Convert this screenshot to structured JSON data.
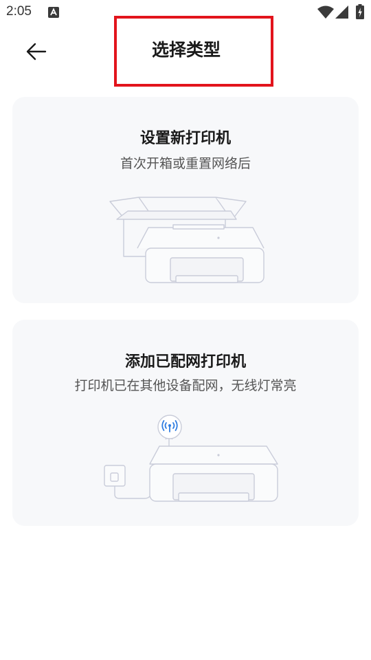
{
  "status_bar": {
    "time": "2:05",
    "icons": [
      "notification-a-icon",
      "wifi-icon",
      "signal-icon",
      "battery-charging-icon"
    ]
  },
  "header": {
    "back_icon": "arrow-left-icon",
    "title": "选择类型",
    "highlight_color": "#e2141c"
  },
  "options": [
    {
      "title": "设置新打印机",
      "subtitle": "首次开箱或重置网络后",
      "illustration": "printer-in-box-illustration"
    },
    {
      "title": "添加已配网打印机",
      "subtitle": "打印机已在其他设备配网，无线灯常亮",
      "illustration": "printer-wifi-illustration"
    }
  ],
  "colors": {
    "card_background": "#f7f8fa",
    "wifi_accent": "#2f7de1",
    "line_art": "#c9ccd9"
  }
}
